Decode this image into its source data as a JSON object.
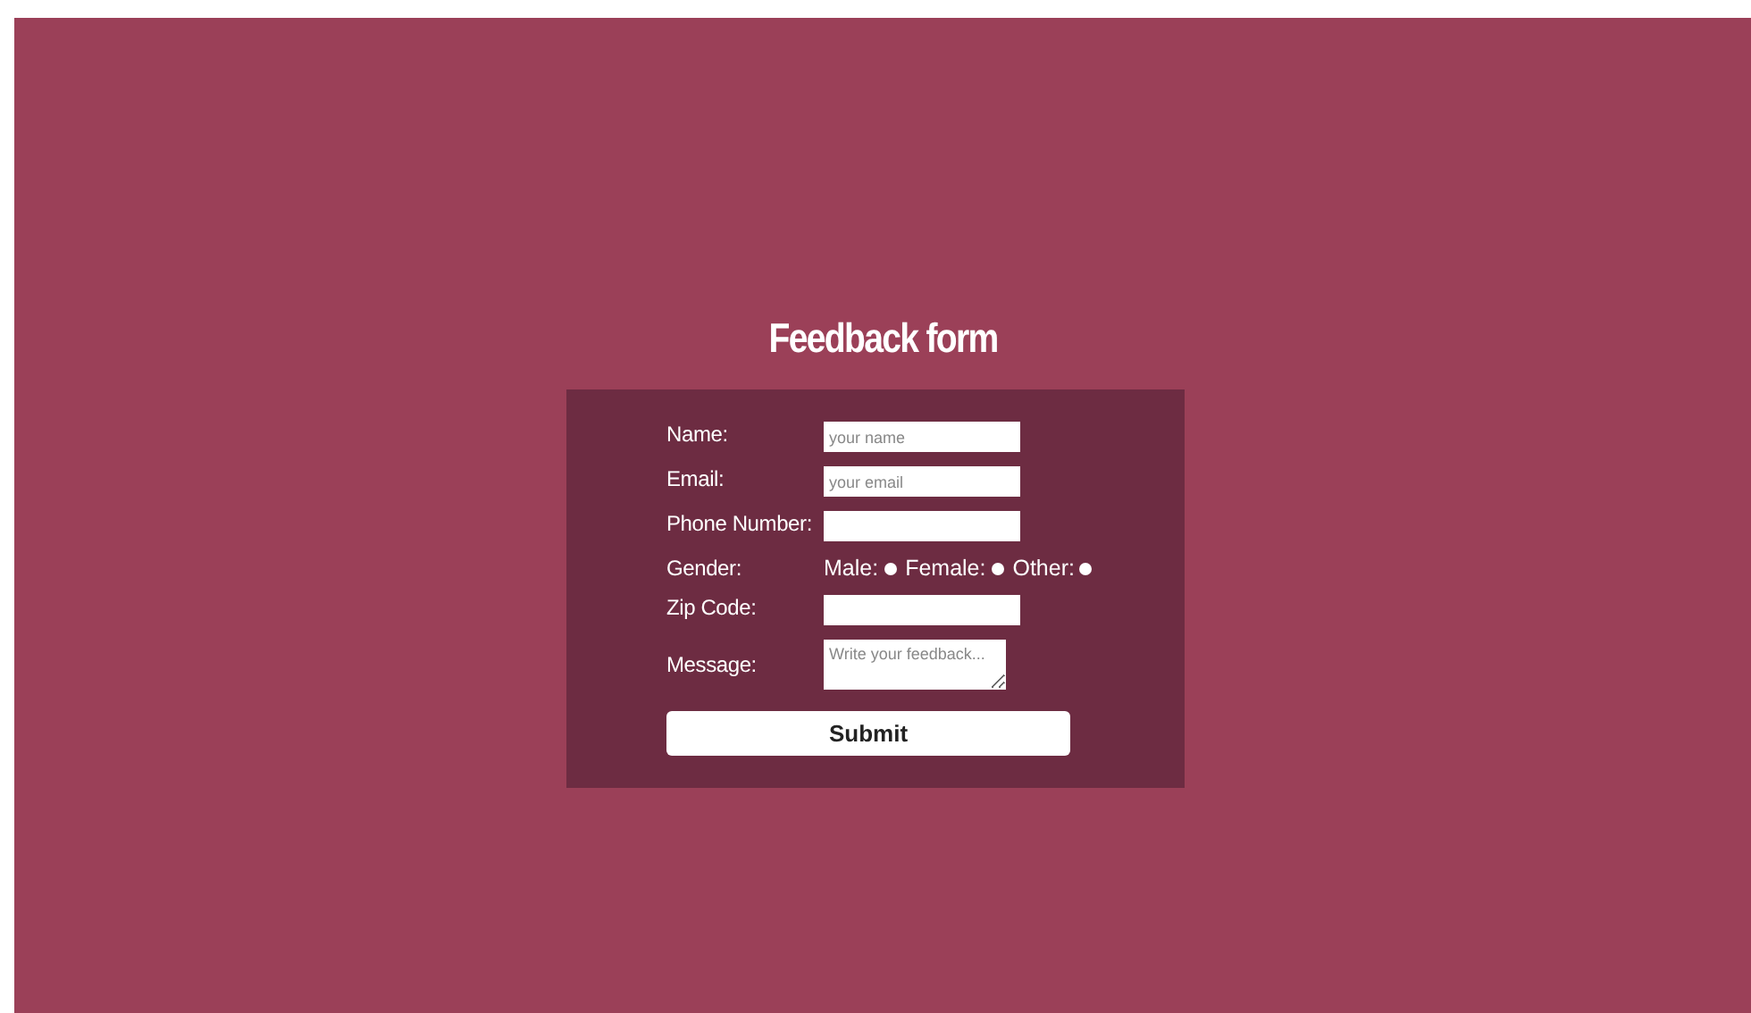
{
  "title": "Feedback form",
  "fields": [
    {
      "kind": "text",
      "label": "Name:",
      "placeholder": "your name"
    },
    {
      "kind": "text",
      "label": "Email:",
      "placeholder": "your email"
    },
    {
      "kind": "text",
      "label": "Phone Number:"
    },
    {
      "kind": "radio",
      "label": "Gender:",
      "options": [
        {
          "label": "Male:",
          "selected": false
        },
        {
          "label": "Female:",
          "selected": false
        },
        {
          "label": "Other:",
          "selected": false
        }
      ]
    },
    {
      "kind": "text",
      "label": "Zip Code:"
    },
    {
      "kind": "textarea",
      "label": "Message:",
      "placeholder": "Write your feedback..."
    }
  ],
  "submit": "Submit"
}
